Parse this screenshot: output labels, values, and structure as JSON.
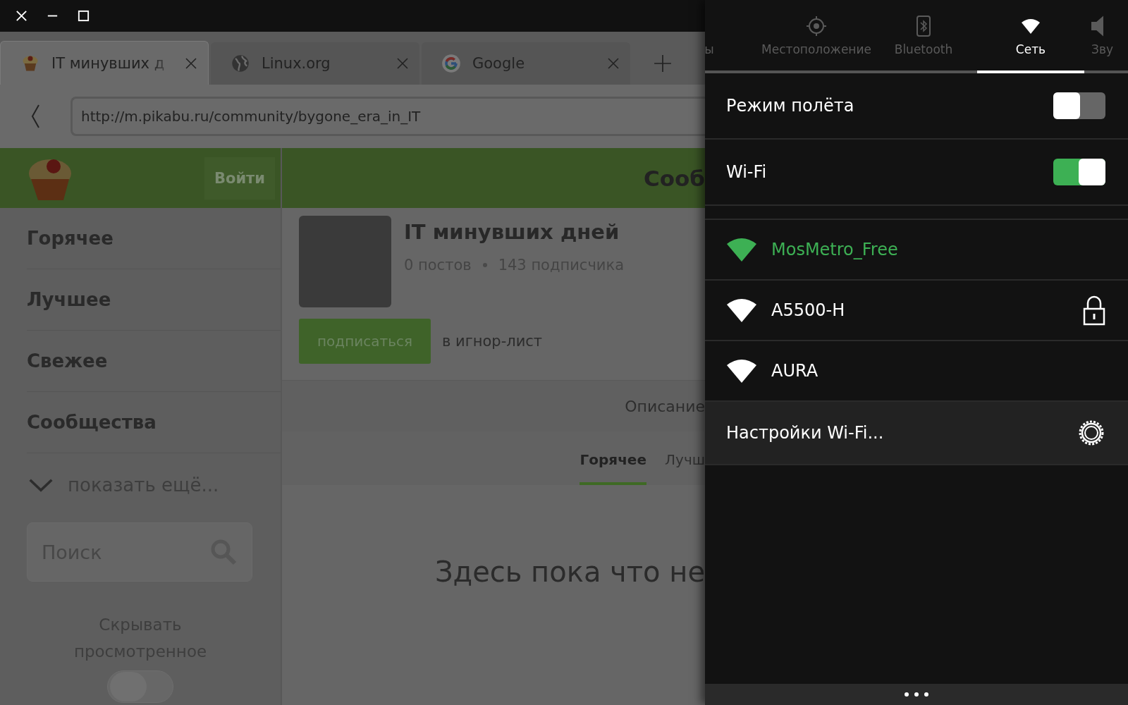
{
  "browser": {
    "tabs": [
      {
        "title": "IT минувших д",
        "kind": "cupcake",
        "selected": true
      },
      {
        "title": "Linux.org",
        "kind": "globe",
        "selected": false
      },
      {
        "title": "Google",
        "kind": "google",
        "selected": false
      }
    ],
    "url": "http://m.pikabu.ru/community/bygone_era_in_IT",
    "page": {
      "login_button": "Войти",
      "header_title": "Сооб",
      "menu": [
        "Горячее",
        "Лучшее",
        "Свежее",
        "Сообщества"
      ],
      "show_more": "показать ещё...",
      "search": {
        "placeholder": "Поиск"
      },
      "hide_viewed": {
        "label": "Скрывать просмотренное",
        "on": false
      },
      "community": {
        "title": "IT минувших дней",
        "posts": "0 постов",
        "subscribers": "143 подписчика",
        "subscribe_button": "подписаться",
        "ignore_link": "в игнор-лист"
      },
      "description_tab": "Описание",
      "feed_tabs": [
        {
          "label": "Горячее",
          "selected": true
        },
        {
          "label": "Лучш",
          "selected": false
        }
      ],
      "empty_message": "Здесь пока что не"
    }
  },
  "panel": {
    "tabs": [
      {
        "label": "ы",
        "kind": "partial",
        "selected": false
      },
      {
        "label": "Местоположение",
        "kind": "location",
        "selected": false
      },
      {
        "label": "Bluetooth",
        "kind": "bluetooth",
        "selected": false
      },
      {
        "label": "Сеть",
        "kind": "network",
        "selected": true
      },
      {
        "label": "Зву",
        "kind": "sound",
        "selected": false
      }
    ],
    "switches": [
      {
        "label": "Режим полёта",
        "on": false
      },
      {
        "label": "Wi-Fi",
        "on": true
      }
    ],
    "networks": [
      {
        "name": "MosMetro_Free",
        "connected": true,
        "locked": false
      },
      {
        "name": "A5500-H",
        "connected": false,
        "locked": true
      },
      {
        "name": "AURA",
        "connected": false,
        "locked": false
      }
    ],
    "settings_label": "Настройки Wi-Fi..."
  }
}
